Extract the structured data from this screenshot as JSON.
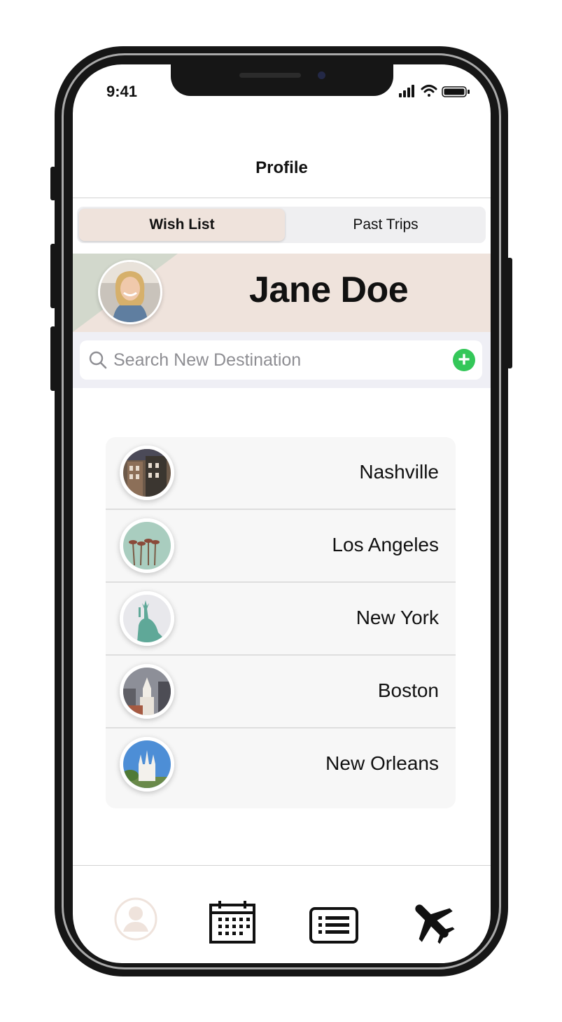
{
  "status_bar": {
    "time": "9:41",
    "icons": [
      "signal-icon",
      "wifi-icon",
      "battery-icon"
    ]
  },
  "nav": {
    "title": "Profile"
  },
  "segments": [
    {
      "label": "Wish List",
      "selected": true
    },
    {
      "label": "Past Trips",
      "selected": false
    }
  ],
  "profile": {
    "name": "Jane Doe",
    "avatar_icon": "profile-photo"
  },
  "search": {
    "placeholder": "Search New Destination",
    "value": "",
    "add_icon": "plus-circle-icon"
  },
  "destinations": [
    {
      "name": "Nashville",
      "thumbnail": "nashville-buildings-photo"
    },
    {
      "name": "Los Angeles",
      "thumbnail": "palm-trees-photo"
    },
    {
      "name": "New York",
      "thumbnail": "statue-of-liberty-photo"
    },
    {
      "name": "Boston",
      "thumbnail": "boston-church-photo"
    },
    {
      "name": "New Orleans",
      "thumbnail": "new-orleans-cathedral-photo"
    }
  ],
  "tab_bar": [
    {
      "icon": "profile-icon",
      "active": true
    },
    {
      "icon": "calendar-icon",
      "active": false
    },
    {
      "icon": "list-icon",
      "active": false
    },
    {
      "icon": "airplane-icon",
      "active": false
    }
  ],
  "colors": {
    "accent_beige": "#efe3dc",
    "sage": "#d2d8cc",
    "add_green": "#34c759",
    "phone_frame": "#161616"
  }
}
